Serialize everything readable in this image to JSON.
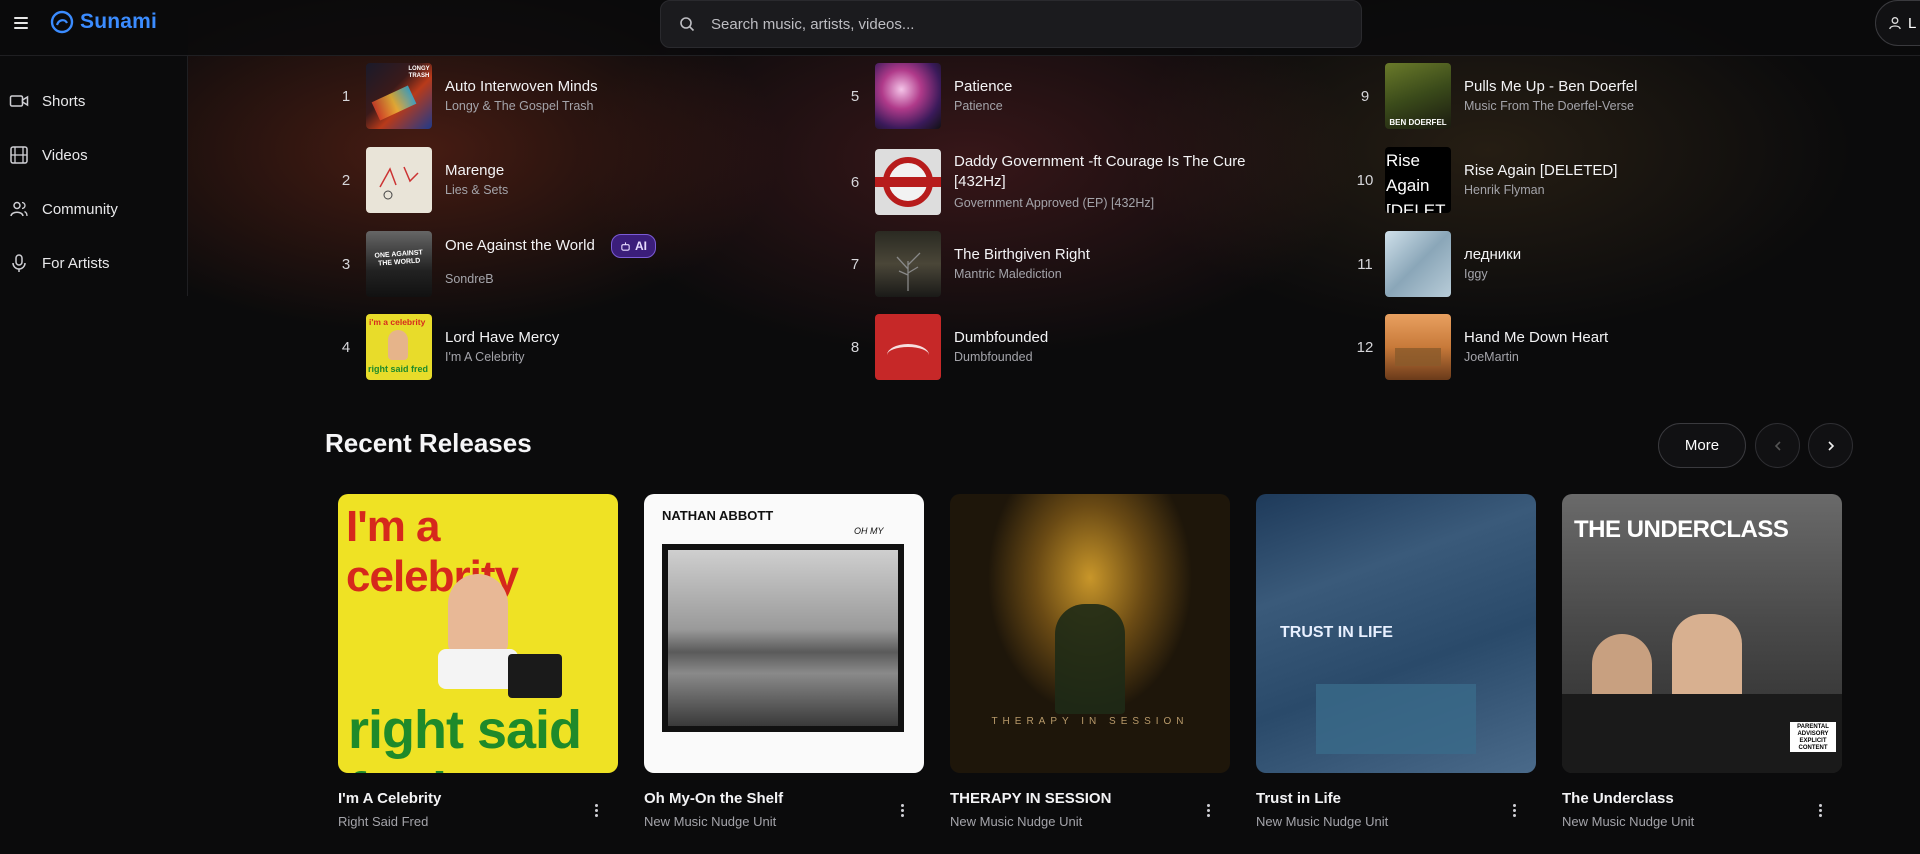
{
  "app": {
    "name": "Sunami"
  },
  "search": {
    "placeholder": "Search music, artists, videos..."
  },
  "user": {
    "label": "L"
  },
  "sidebar": {
    "items": [
      {
        "label": "Shorts",
        "icon": "video-camera-icon"
      },
      {
        "label": "Videos",
        "icon": "film-icon"
      },
      {
        "label": "Community",
        "icon": "users-icon"
      },
      {
        "label": "For Artists",
        "icon": "microphone-icon"
      }
    ]
  },
  "top_chart": [
    {
      "rank": "1",
      "title": "Auto Interwoven Minds",
      "artist": "Longy & The Gospel Trash"
    },
    {
      "rank": "2",
      "title": "Marenge",
      "artist": "Lies & Sets"
    },
    {
      "rank": "3",
      "title": "One Against the World",
      "artist": "SondreB",
      "badge": "AI"
    },
    {
      "rank": "4",
      "title": "Lord Have Mercy",
      "artist": "I'm A Celebrity"
    },
    {
      "rank": "5",
      "title": "Patience",
      "artist": "Patience"
    },
    {
      "rank": "6",
      "title": "Daddy Government -ft Courage Is The Cure [432Hz]",
      "artist": "Government Approved (EP) [432Hz]"
    },
    {
      "rank": "7",
      "title": "The Birthgiven Right",
      "artist": "Mantric Malediction"
    },
    {
      "rank": "8",
      "title": "Dumbfounded",
      "artist": "Dumbfounded"
    },
    {
      "rank": "9",
      "title": "Pulls Me Up - Ben Doerfel",
      "artist": "Music From The Doerfel-Verse"
    },
    {
      "rank": "10",
      "title": "Rise Again [DELETED]",
      "artist": "Henrik Flyman"
    },
    {
      "rank": "11",
      "title": "ледники",
      "artist": "Iggy"
    },
    {
      "rank": "12",
      "title": "Hand Me Down Heart",
      "artist": "JoeMartin"
    }
  ],
  "cover_text": {
    "c1": "LONGY TRASH",
    "c3": "ONE AGAINST THE WORLD",
    "c4": "i'm a celebrity",
    "c4b": "right said fred",
    "c9": "BEN DOERFEL",
    "c10": "Rise Again [DELETE",
    "r1a": "I'm a celebrity",
    "r1b": "right said fred",
    "r2a": "NATHAN ABBOTT",
    "r2b": "OH MY",
    "r3": "THERAPY IN SESSION",
    "r4": "TRUST IN LIFE",
    "r5": "THE UNDERCLASS",
    "r5b": "PARENTAL ADVISORY EXPLICIT CONTENT"
  },
  "recent_releases": {
    "heading": "Recent Releases",
    "more_label": "More",
    "items": [
      {
        "title": "I'm A Celebrity",
        "artist": "Right Said Fred"
      },
      {
        "title": "Oh My-On the Shelf",
        "artist": "New Music Nudge Unit"
      },
      {
        "title": "THERAPY IN SESSION",
        "artist": "New Music Nudge Unit"
      },
      {
        "title": "Trust in Life",
        "artist": "New Music Nudge Unit"
      },
      {
        "title": "The Underclass",
        "artist": "New Music Nudge Unit"
      }
    ]
  },
  "colors": {
    "accent": "#3b8cff",
    "background": "#0b0b0c",
    "ai_badge": "#3b1e7a"
  }
}
